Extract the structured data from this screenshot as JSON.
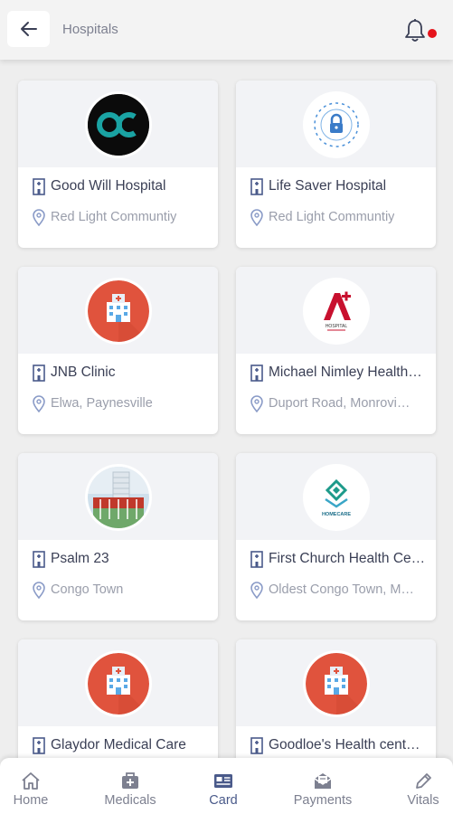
{
  "header": {
    "title": "Hospitals",
    "back_icon": "arrow-left-icon",
    "bell_icon": "bell-icon",
    "notification_color": "#e5141c"
  },
  "hospitals": [
    {
      "name": "Good Will Hospital",
      "location": "Red Light Communtiy"
    },
    {
      "name": "Life Saver Hospital",
      "location": "Red Light Communtiy"
    },
    {
      "name": "JNB Clinic",
      "location": "Elwa, Paynesville"
    },
    {
      "name": "Michael Nimley Health…",
      "location": "Duport Road, Monrovi…"
    },
    {
      "name": "Psalm 23",
      "location": "Congo Town"
    },
    {
      "name": "First Church Health Ce…",
      "location": "Oldest Congo Town, M…"
    },
    {
      "name": "Glaydor Medical Care",
      "location": ""
    },
    {
      "name": "Goodloe's Health cent…",
      "location": ""
    }
  ],
  "logos": {
    "hospital_icon_bg": "#e0533d",
    "logo_hospital_text": "HOSPITAL",
    "logo_homecare_text": "HOMECARE"
  },
  "nav": {
    "items": [
      {
        "label": "Home",
        "icon": "home-icon"
      },
      {
        "label": "Medicals",
        "icon": "medical-kit-icon"
      },
      {
        "label": "Card",
        "icon": "card-icon"
      },
      {
        "label": "Payments",
        "icon": "payments-icon"
      },
      {
        "label": "Vitals",
        "icon": "pencil-icon"
      }
    ],
    "active_index": 2,
    "active_color": "#4a5a8a"
  }
}
